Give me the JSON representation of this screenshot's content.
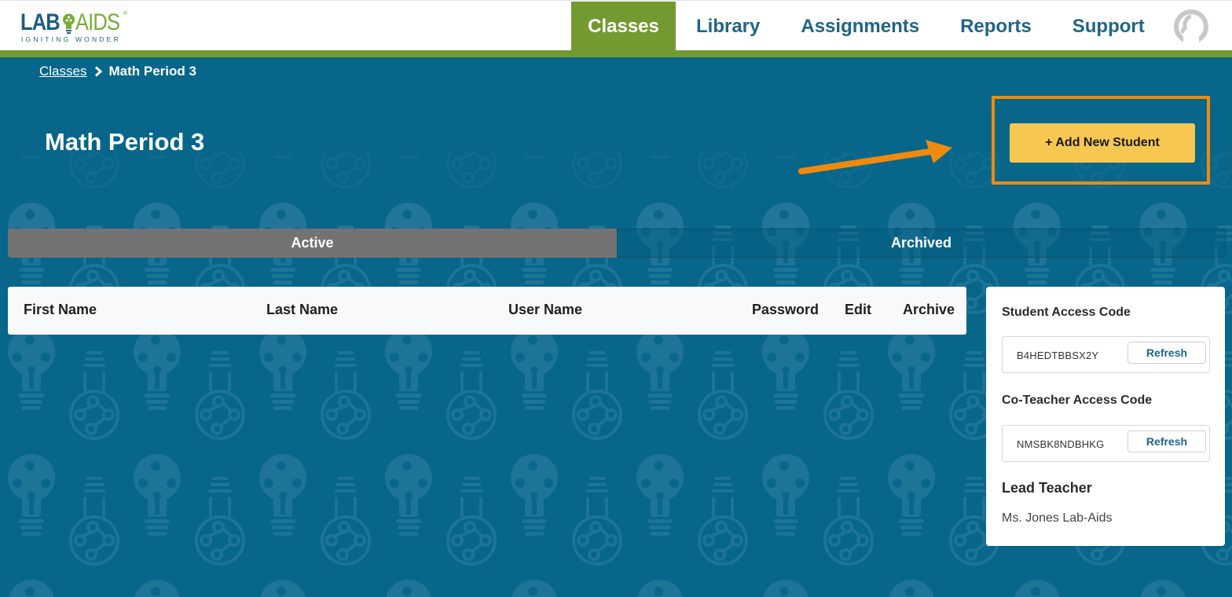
{
  "header": {
    "logo": {
      "primary": "LAB",
      "secondary": "AIDS",
      "tagline": "IGNITING WONDER",
      "registered": "®"
    },
    "nav": [
      {
        "label": "Classes",
        "active": true
      },
      {
        "label": "Library",
        "active": false
      },
      {
        "label": "Assignments",
        "active": false
      },
      {
        "label": "Reports",
        "active": false
      },
      {
        "label": "Support",
        "active": false
      }
    ],
    "avatar_icon": "user-avatar-icon"
  },
  "breadcrumb": {
    "items": [
      "Classes",
      "Math Period 3"
    ],
    "separator_icon": "chevron-right-icon"
  },
  "page": {
    "title": "Math Period 3",
    "add_student_label": "+ Add New Student"
  },
  "annotation": {
    "arrow_color": "#f08a0c",
    "highlight_color": "#f08a0c"
  },
  "tabs": [
    {
      "label": "Active",
      "active": true
    },
    {
      "label": "Archived",
      "active": false
    }
  ],
  "table": {
    "columns": [
      "First Name",
      "Last Name",
      "User Name",
      "Password",
      "Edit",
      "Archive"
    ],
    "rows": []
  },
  "side_panel": {
    "student_code_label": "Student Access Code",
    "student_code": "B4HEDTBBSX2Y",
    "coteacher_code_label": "Co-Teacher Access Code",
    "coteacher_code": "NMSBK8NDBHKG",
    "refresh_label": "Refresh",
    "lead_teacher_label": "Lead Teacher",
    "lead_teacher_name": "Ms. Jones Lab-Aids"
  },
  "colors": {
    "brand_blue": "#07668a",
    "brand_green": "#739a31",
    "button_yellow": "#f6c851",
    "tab_active": "#737373"
  }
}
